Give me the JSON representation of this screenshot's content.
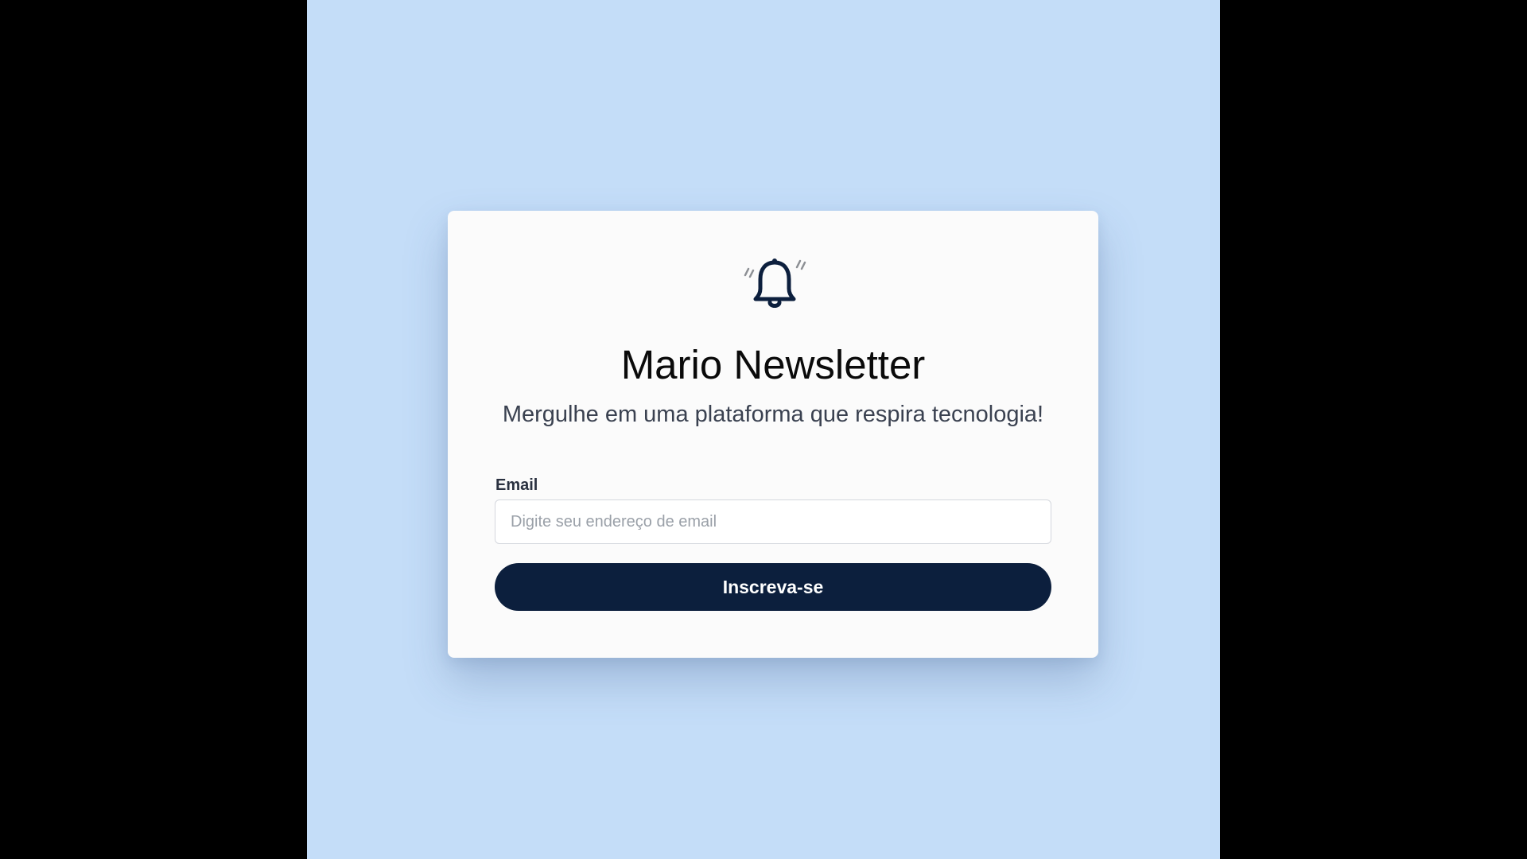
{
  "header": {
    "icon": "bell-ringing-icon",
    "title": "Mario Newsletter",
    "subtitle": "Mergulhe em uma plataforma que respira tecnologia!"
  },
  "form": {
    "email_label": "Email",
    "email_placeholder": "Digite seu endereço de email",
    "email_value": "",
    "submit_label": "Inscreva-se"
  },
  "colors": {
    "background": "#c4ddf8",
    "card": "#fbfbfb",
    "button": "#0c1f3d",
    "bell_stroke": "#0c1f3d"
  }
}
